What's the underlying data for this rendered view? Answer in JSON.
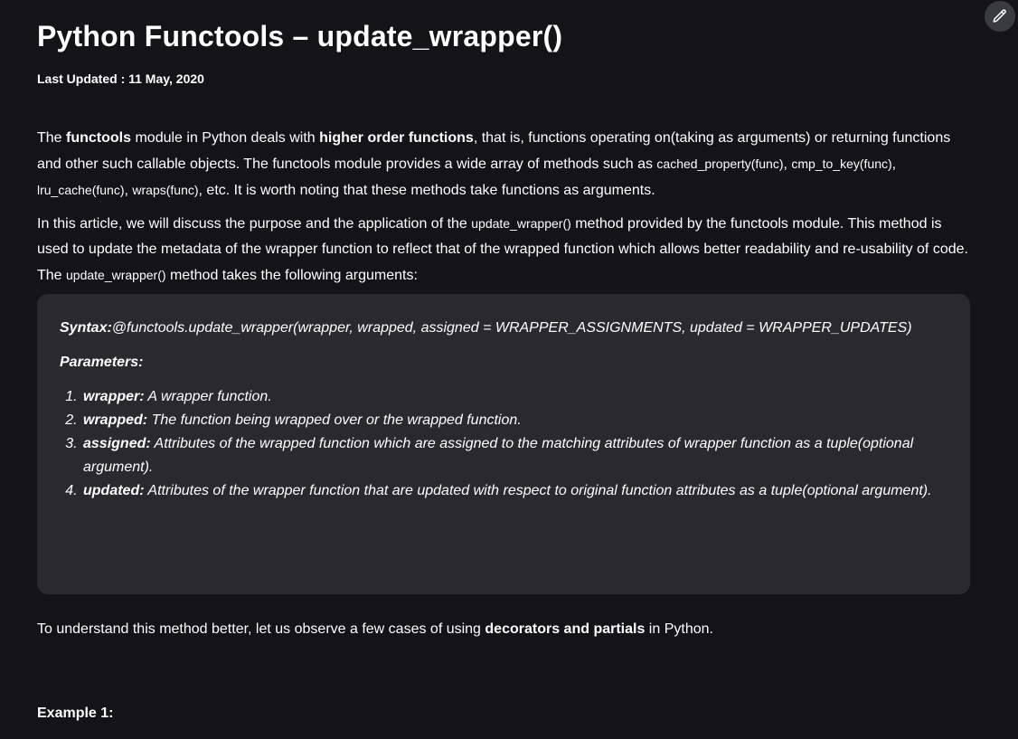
{
  "page": {
    "title": "Python Functools – update_wrapper()",
    "last_updated": "Last Updated : 11 May, 2020",
    "edit_icon": "pencil-icon"
  },
  "para1": {
    "t1": "The ",
    "b1": "functools",
    "t2": " module in Python deals with ",
    "b2": "higher order functions",
    "t3": ", that is, functions operating on(taking as arguments) or returning functions and other such callable objects. The functools module provides a wide array of methods such as ",
    "c1": "cached_property(func)",
    "t4": ", ",
    "c2": "cmp_to_key(func)",
    "t5": ", ",
    "c3": "lru_cache(func)",
    "t6": ", ",
    "c4": "wraps(func)",
    "t7": ", etc. It is worth noting that these methods take functions as arguments."
  },
  "para2": {
    "t1": "In this article, we will discuss the purpose and the application of the ",
    "c1": "update_wrapper()",
    "t2": " method provided by the functools module. This method is used to update the metadata of the wrapper function to reflect that of the wrapped function which allows better readability and re-usability of code. The ",
    "c2": "update_wrapper()",
    "t3": " method takes the following arguments:"
  },
  "syntax": {
    "label": "Syntax:",
    "text": "@functools.update_wrapper(wrapper, wrapped, assigned = WRAPPER_ASSIGNMENTS, updated = WRAPPER_UPDATES)",
    "params_label": "Parameters:",
    "params": [
      {
        "name": "wrapper:",
        "desc": " A wrapper function."
      },
      {
        "name": "wrapped:",
        "desc": " The function being wrapped over or the wrapped function."
      },
      {
        "name": "assigned:",
        "desc": " Attributes of the wrapped function which are assigned to the matching attributes of wrapper function as a tuple(optional argument)."
      },
      {
        "name": "updated:",
        "desc": " Attributes of the wrapper function that are updated with respect to original function attributes as a tuple(optional argument)."
      }
    ]
  },
  "para3": {
    "t1": "To understand this method better, let us observe a few cases of using ",
    "b1": "decorators and partials",
    "t2": " in Python."
  },
  "example1": "Example 1:"
}
